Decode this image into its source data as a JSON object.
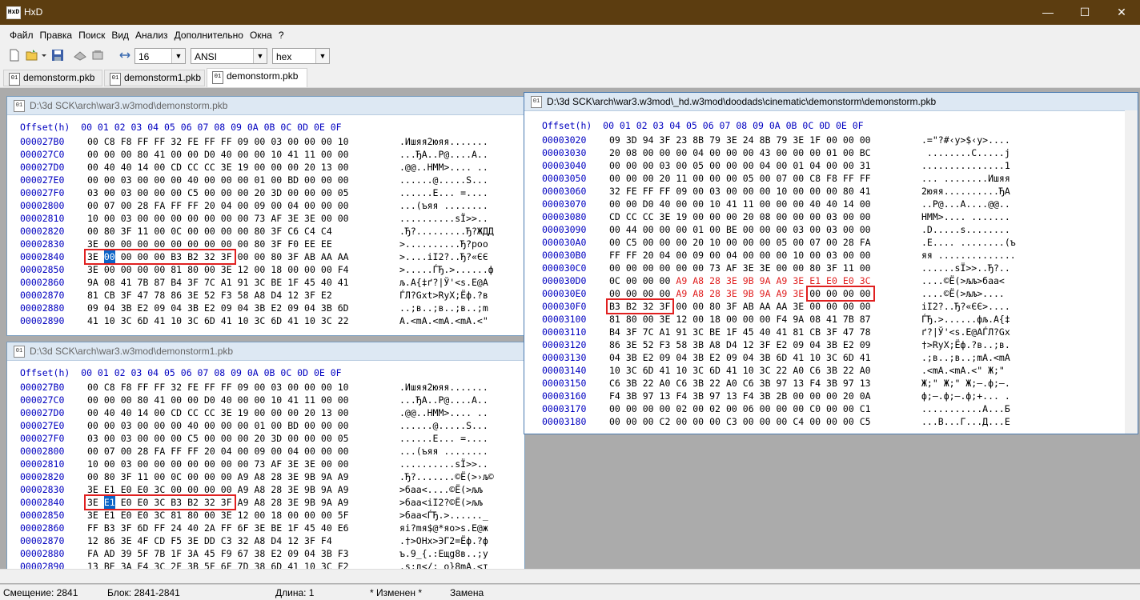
{
  "app": {
    "title": "HxD"
  },
  "window_controls": {
    "minimize": "—",
    "maximize": "☐",
    "close": "✕"
  },
  "menu": [
    "Файл",
    "Правка",
    "Поиск",
    "Вид",
    "Анализ",
    "Дополнительно",
    "Окна",
    "?"
  ],
  "toolbar": {
    "bytes_per_row": "16",
    "charset": "ANSI",
    "offset_base": "hex"
  },
  "tabs": [
    {
      "label": "demonstorm.pkb",
      "active": false
    },
    {
      "label": "demonstorm1.pkb",
      "active": false
    },
    {
      "label": "demonstorm.pkb",
      "active": true
    }
  ],
  "windows": [
    {
      "title": "D:\\3d SCK\\arch\\war3.w3mod\\demonstorm.pkb",
      "header": "Offset(h)  00 01 02 03 04 05 06 07 08 09 0A 0B 0C 0D 0E 0F",
      "rows": [
        {
          "offset": "000027B0",
          "hex": "00 C8 F8 FF FF 32 FE FF FF 09 00 03 00 00 00 10",
          "ascii": ".Ишяя2юяя......."
        },
        {
          "offset": "000027C0",
          "hex": "00 00 00 80 41 00 00 D0 40 00 00 10 41 11 00 00",
          "ascii": "...ЂA..Р@....A.."
        },
        {
          "offset": "000027D0",
          "hex": "00 40 40 14 00 CD CC CC 3E 19 00 00 00 20 13 00",
          "ascii": ".@@..НММ>.... .."
        },
        {
          "offset": "000027E0",
          "hex": "00 00 03 00 00 00 40 00 00 00 01 00 BD 00 00 00",
          "ascii": "......@.....S..."
        },
        {
          "offset": "000027F0",
          "hex": "03 00 03 00 00 00 C5 00 00 00 20 3D 00 00 00 05",
          "ascii": "......Е... =...."
        },
        {
          "offset": "00002800",
          "hex": "00 07 00 28 FA FF FF 20 04 00 09 00 04 00 00 00",
          "ascii": "...(ъяя ........"
        },
        {
          "offset": "00002810",
          "hex": "10 00 03 00 00 00 00 00 00 00 73 AF 3E 3E 00 00",
          "ascii": "..........sЇ>>.."
        },
        {
          "offset": "00002820",
          "hex": "00 80 3F 11 00 0C 00 00 00 00 80 3F C6 C4 C4",
          "ascii": ".Ђ?.........Ђ?ЖДД"
        },
        {
          "offset": "00002830",
          "hex": "3E 00 00 00 00 00 00 00 00 00 80 3F F0 EE EE",
          "ascii": ">..........Ђ?роо"
        },
        {
          "offset": "00002840",
          "hex": "3E 00 00 00 00 B3 B2 32 3F 00 00 80 3F AB AA AA",
          "ascii": ">....іІ2?..Ђ?«ЄЄ"
        },
        {
          "offset": "00002850",
          "hex": "3E 00 00 00 00 81 80 00 3E 12 00 18 00 00 00 F4",
          "ascii": ">.....ЃЂ.>......ф"
        },
        {
          "offset": "00002860",
          "hex": "9A 08 41 7B 87 B4 3F 7C A1 91 3C BE 1F 45 40 41",
          "ascii": "љ.A{‡ґ?|Ў'<s.E@A"
        },
        {
          "offset": "00002870",
          "hex": "81 CB 3F 47 78 86 3E 52 F3 58 A8 D4 12 3F E2",
          "ascii": "ЃЛ?Gxt>RуX;Ёф.?в"
        },
        {
          "offset": "00002880",
          "hex": "09 04 3B E2 09 04 3B E2 09 04 3B E2 09 04 3B 6D",
          "ascii": "..;в..;в..;в..;m"
        },
        {
          "offset": "00002890",
          "hex": "41 10 3C 6D 41 10 3C 6D 41 10 3C 6D 41 10 3C 22",
          "ascii": "A.<mA.<mA.<mA.<\""
        }
      ]
    },
    {
      "title": "D:\\3d SCK\\arch\\war3.w3mod\\demonstorm1.pkb",
      "header": "Offset(h)  00 01 02 03 04 05 06 07 08 09 0A 0B 0C 0D 0E 0F",
      "rows": [
        {
          "offset": "000027B0",
          "hex": "00 C8 F8 FF FF 32 FE FF FF 09 00 03 00 00 00 10",
          "ascii": ".Ишяя2юяя......."
        },
        {
          "offset": "000027C0",
          "hex": "00 00 00 80 41 00 00 D0 40 00 00 10 41 11 00 00",
          "ascii": "...ЂA..Р@....A.."
        },
        {
          "offset": "000027D0",
          "hex": "00 40 40 14 00 CD CC CC 3E 19 00 00 00 20 13 00",
          "ascii": ".@@..НММ>.... .."
        },
        {
          "offset": "000027E0",
          "hex": "00 00 03 00 00 00 40 00 00 00 01 00 BD 00 00 00",
          "ascii": "......@.....S..."
        },
        {
          "offset": "000027F0",
          "hex": "03 00 03 00 00 00 C5 00 00 00 20 3D 00 00 00 05",
          "ascii": "......Е... =...."
        },
        {
          "offset": "00002800",
          "hex": "00 07 00 28 FA FF FF 20 04 00 09 00 04 00 00 00",
          "ascii": "...(ъяя ........"
        },
        {
          "offset": "00002810",
          "hex": "10 00 03 00 00 00 00 00 00 00 73 AF 3E 3E 00 00",
          "ascii": "..........sЇ>>.."
        },
        {
          "offset": "00002820",
          "hex": "00 80 3F 11 00 0C 00 00 00 A9 A8 28 3E 9B 9A A9",
          "ascii": ".Ђ?.......©Ё(>›љ©"
        },
        {
          "offset": "00002830",
          "hex": "3E E1 E0 E0 3C 00 00 00 00 A9 A8 28 3E 9B 9A A9",
          "ascii": ">баа<....©Ё(>љљ"
        },
        {
          "offset": "00002840",
          "hex": "3E E1 E0 E0 3C B3 B2 32 3F A9 A8 28 3E 9B 9A A9",
          "ascii": ">баа<іІ2?©Ё(>љљ"
        },
        {
          "offset": "00002850",
          "hex": "3E E1 E0 E0 3C 81 80 00 3E 12 00 18 00 00 00 5F",
          "ascii": ">баа<ЃЂ.>......_"
        },
        {
          "offset": "00002860",
          "hex": "FF B3 3F 6D FF 24 40 2A FF 6F 3E BE 1F 45 40 E6",
          "ascii": "яі?mя$@*яо>s.E@ж"
        },
        {
          "offset": "00002870",
          "hex": "12 86 3E 4F CD F5 3E DD C3 32 A8 D4 12 3F F4",
          "ascii": ".†>OНх>ЭГ2=Ёф.?ф"
        },
        {
          "offset": "00002880",
          "hex": "FA AD 39 5F 7B 1F 3A 45 F9 67 38 E2 09 04 3B F3",
          "ascii": "ъ.9_{.:Eщg8в..;у"
        },
        {
          "offset": "00002890",
          "hex": "13 BE 3A E4 3C 2F 3B 5F 6F 7D 38 6D 41 10 3C F2",
          "ascii": ".s:д</;_o}8mA.<т"
        }
      ]
    },
    {
      "title": "D:\\3d SCK\\arch\\war3.w3mod\\_hd.w3mod\\doodads\\cinematic\\demonstorm\\demonstorm.pkb",
      "header": "Offset(h)  00 01 02 03 04 05 06 07 08 09 0A 0B 0C 0D 0E 0F",
      "rows": [
        {
          "offset": "00003020",
          "hex": "09 3D 94 3F 23 8B 79 3E 24 8B 79 3E 1F 00 00 00",
          "ascii": ".=\"?#‹y>$‹y>...."
        },
        {
          "offset": "00003030",
          "hex": "20 08 00 00 00 04 00 00 00 43 00 00 00 01 00 BC",
          "ascii": " ........C.....j"
        },
        {
          "offset": "00003040",
          "hex": "00 00 00 03 00 05 00 00 00 04 00 01 04 00 00 31",
          "ascii": "...............1"
        },
        {
          "offset": "00003050",
          "hex": "00 00 00 20 11 00 00 00 05 00 07 00 C8 F8 FF FF",
          "ascii": "... ........Ишяя"
        },
        {
          "offset": "00003060",
          "hex": "32 FE FF FF 09 00 03 00 00 00 10 00 00 00 80 41",
          "ascii": "2юяя..........ЂA"
        },
        {
          "offset": "00003070",
          "hex": "00 00 D0 40 00 00 10 41 11 00 00 00 40 40 14 00",
          "ascii": "..Р@...A....@@.."
        },
        {
          "offset": "00003080",
          "hex": "CD CC CC 3E 19 00 00 00 20 08 00 00 00 03 00 00",
          "ascii": "НММ>.... ......."
        },
        {
          "offset": "00003090",
          "hex": "00 44 00 00 00 01 00 BE 00 00 00 03 00 03 00 00",
          "ascii": ".D.....s........"
        },
        {
          "offset": "000030A0",
          "hex": "00 C5 00 00 00 20 10 00 00 00 05 00 07 00 28 FA",
          "ascii": ".Е.... ........(ъ"
        },
        {
          "offset": "000030B0",
          "hex": "FF FF 20 04 00 09 00 04 00 00 00 10 00 03 00 00",
          "ascii": "яя .............."
        },
        {
          "offset": "000030C0",
          "hex": "00 00 00 00 00 00 73 AF 3E 3E 00 00 80 3F 11 00",
          "ascii": "......sЇ>>..Ђ?.."
        },
        {
          "offset": "000030D0",
          "hex": "0C 00 00 00 A9 A8 28 3E 9B 9A A9 3E E1 E0 E0 3C",
          "ascii": "....©Ё(>љљ>баа<"
        },
        {
          "offset": "000030E0",
          "hex": "00 00 00 00 A9 A8 28 3E 9B 9A A9 3E 00 00 00 00",
          "ascii": "....©Ё(>љљ>...."
        },
        {
          "offset": "000030F0",
          "hex": "B3 B2 32 3F 00 00 80 3F AB AA AA 3E 00 00 00 00",
          "ascii": "іІ2?..Ђ?«ЄЄ>...."
        },
        {
          "offset": "00003100",
          "hex": "81 80 00 3E 12 00 18 00 00 00 F4 9A 08 41 7B 87",
          "ascii": "ЃЂ.>......фљ.A{‡"
        },
        {
          "offset": "00003110",
          "hex": "B4 3F 7C A1 91 3C BE 1F 45 40 41 81 CB 3F 47 78",
          "ascii": "ґ?|Ў'<s.E@AЃЛ?Gx"
        },
        {
          "offset": "00003120",
          "hex": "86 3E 52 F3 58 3B A8 D4 12 3F E2 09 04 3B E2 09",
          "ascii": "†>RуX;Ёф.?в..;в."
        },
        {
          "offset": "00003130",
          "hex": "04 3B E2 09 04 3B E2 09 04 3B 6D 41 10 3C 6D 41",
          "ascii": ".;в..;в..;mA.<mA"
        },
        {
          "offset": "00003140",
          "hex": "10 3C 6D 41 10 3C 6D 41 10 3C 22 A0 C6 3B 22 A0",
          "ascii": ".<mA.<mA.<\" Ж;\""
        },
        {
          "offset": "00003150",
          "hex": "C6 3B 22 A0 C6 3B 22 A0 C6 3B 97 13 F4 3B 97 13",
          "ascii": "Ж;\" Ж;\" Ж;—.ф;—."
        },
        {
          "offset": "00003160",
          "hex": "F4 3B 97 13 F4 3B 97 13 F4 3B 2B 00 00 00 20 0A",
          "ascii": "ф;—.ф;—.ф;+... ."
        },
        {
          "offset": "00003170",
          "hex": "00 00 00 00 02 00 02 00 06 00 00 00 C0 00 00 C1",
          "ascii": "...........A...Б"
        },
        {
          "offset": "00003180",
          "hex": "00 00 00 C2 00 00 00 C3 00 00 00 C4 00 00 00 C5",
          "ascii": "...В...Г...Д...Е"
        }
      ]
    }
  ],
  "status": {
    "offset": "Смещение: 2841",
    "block": "Блок: 2841-2841",
    "length": "Длина: 1",
    "modified": "* Изменен *",
    "mode": "Замена"
  },
  "colors": {
    "title_bar": "#5c3d10",
    "offset_color": "#0000c0",
    "highlight_red": "#e02020",
    "selection_blue": "#0a64c8"
  }
}
